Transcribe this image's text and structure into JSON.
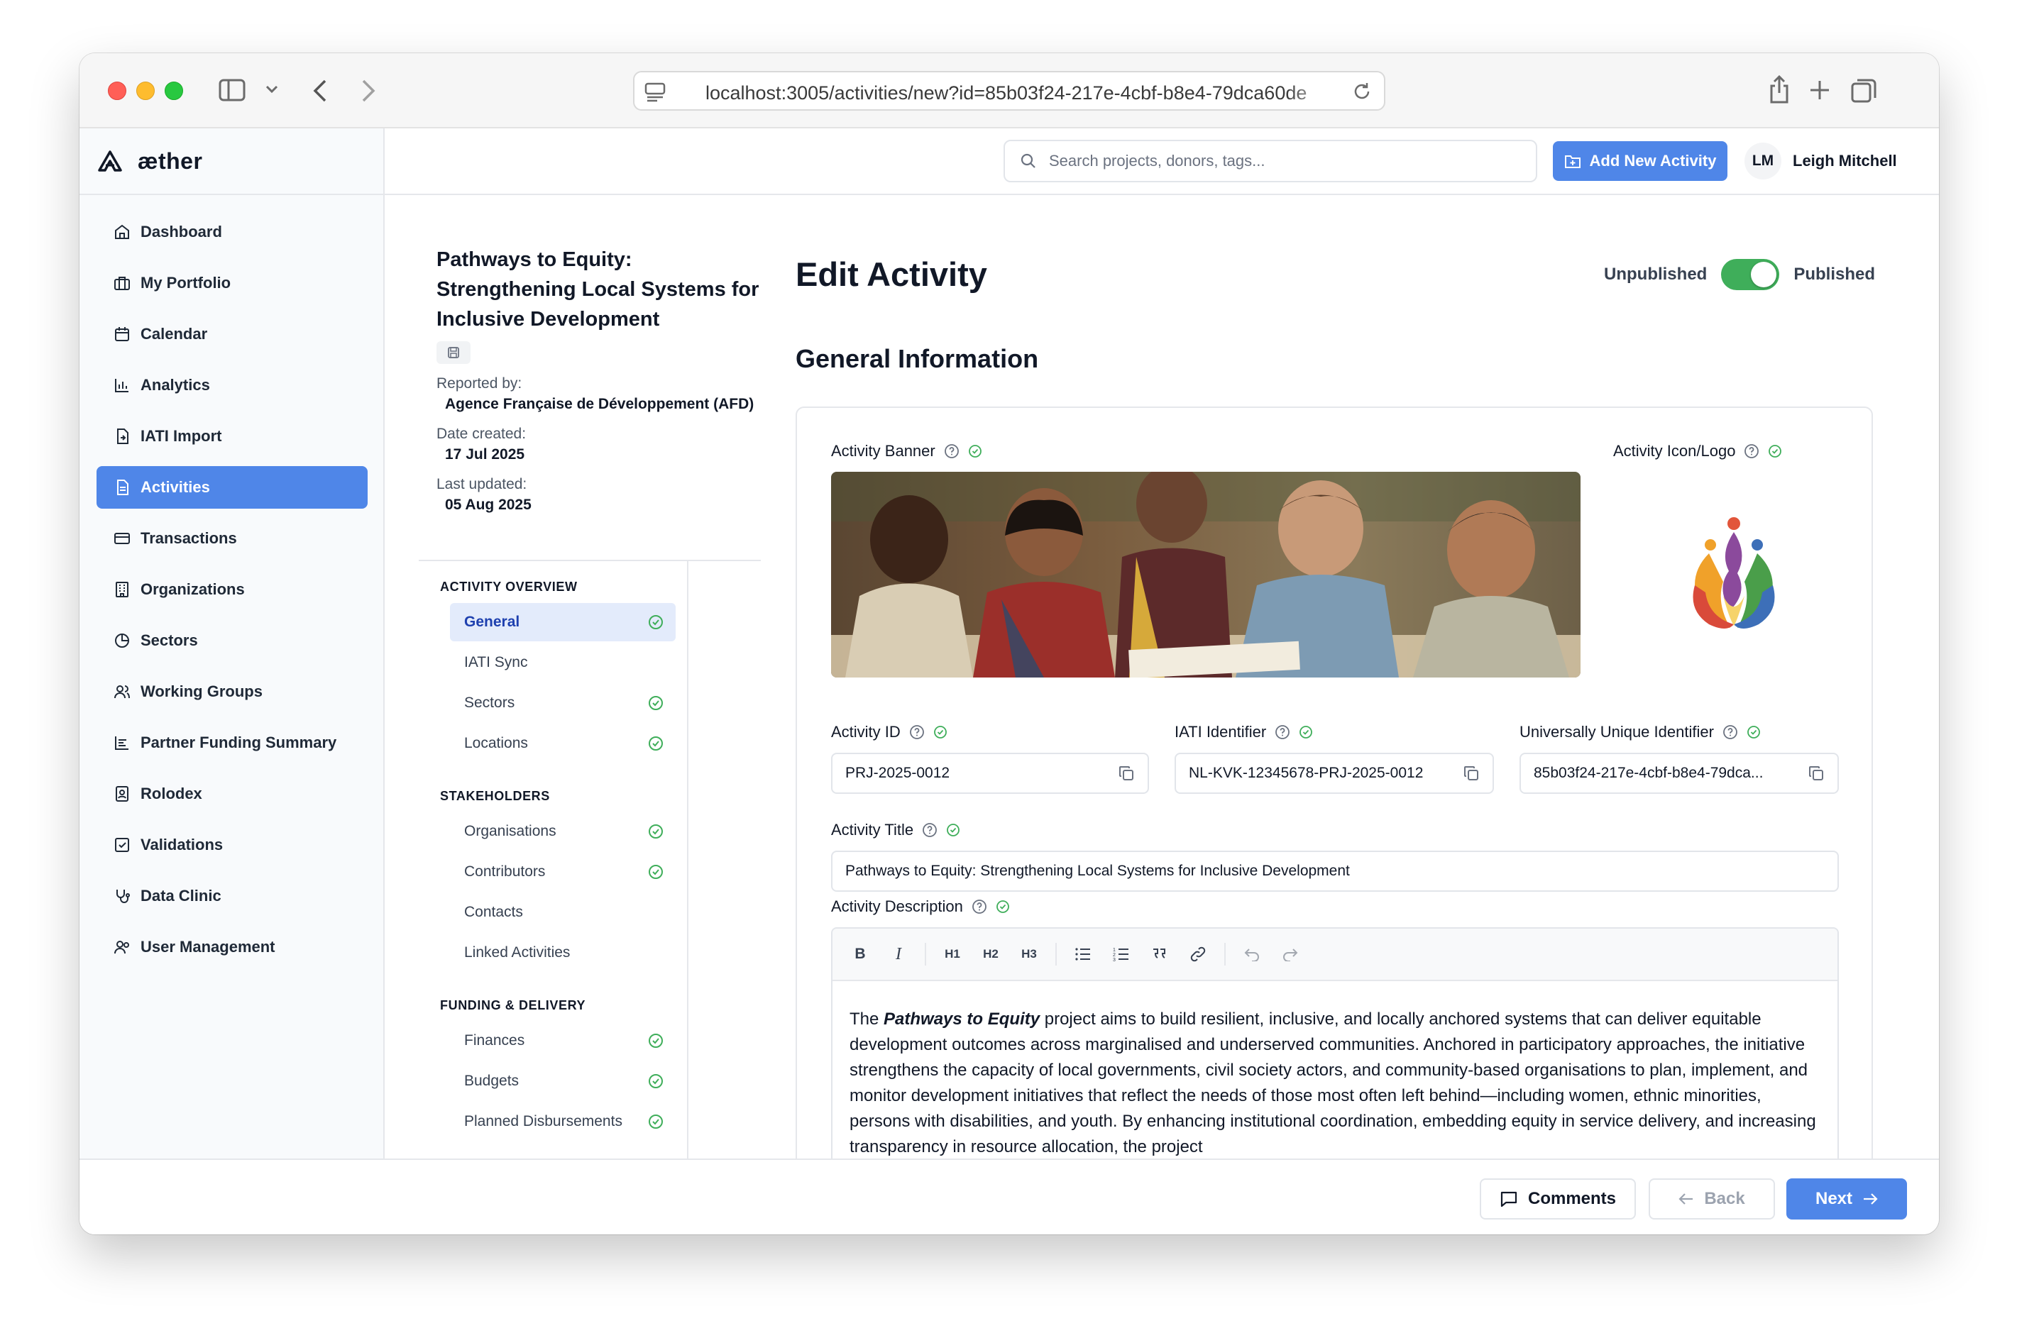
{
  "browser": {
    "url": "localhost:3005/activities/new?id=85b03f24-217e-4cbf-b8e4-79dca60de"
  },
  "app": {
    "brand": "æther",
    "search_placeholder": "Search projects, donors, tags...",
    "add_button": "Add New Activity",
    "user_initials": "LM",
    "user_name": "Leigh Mitchell"
  },
  "sidebar": {
    "items": [
      {
        "label": "Dashboard",
        "icon": "home-icon"
      },
      {
        "label": "My Portfolio",
        "icon": "briefcase-icon"
      },
      {
        "label": "Calendar",
        "icon": "calendar-icon"
      },
      {
        "label": "Analytics",
        "icon": "bar-chart-icon"
      },
      {
        "label": "IATI Import",
        "icon": "file-import-icon"
      },
      {
        "label": "Activities",
        "icon": "file-text-icon",
        "active": true
      },
      {
        "label": "Transactions",
        "icon": "credit-card-icon"
      },
      {
        "label": "Organizations",
        "icon": "building-icon"
      },
      {
        "label": "Sectors",
        "icon": "pie-chart-icon"
      },
      {
        "label": "Working Groups",
        "icon": "users-icon"
      },
      {
        "label": "Partner Funding Summary",
        "icon": "list-chart-icon"
      },
      {
        "label": "Rolodex",
        "icon": "contact-book-icon"
      },
      {
        "label": "Validations",
        "icon": "check-square-icon"
      },
      {
        "label": "Data Clinic",
        "icon": "stethoscope-icon"
      },
      {
        "label": "User Management",
        "icon": "user-group-icon"
      }
    ]
  },
  "summary": {
    "title": "Pathways to Equity: Strengthening Local Systems for Inclusive Development",
    "reported_by_label": "Reported by:",
    "reported_by": "Agence Française de Développement (AFD)",
    "date_created_label": "Date created:",
    "date_created": "17 Jul 2025",
    "last_updated_label": "Last updated:",
    "last_updated": "05 Aug 2025"
  },
  "subnav": {
    "sections": [
      {
        "title": "ACTIVITY OVERVIEW",
        "items": [
          {
            "label": "General",
            "done": true,
            "active": true
          },
          {
            "label": "IATI Sync",
            "done": false
          },
          {
            "label": "Sectors",
            "done": true
          },
          {
            "label": "Locations",
            "done": true
          }
        ]
      },
      {
        "title": "STAKEHOLDERS",
        "items": [
          {
            "label": "Organisations",
            "done": true
          },
          {
            "label": "Contributors",
            "done": true
          },
          {
            "label": "Contacts",
            "done": false
          },
          {
            "label": "Linked Activities",
            "done": false
          }
        ]
      },
      {
        "title": "FUNDING & DELIVERY",
        "items": [
          {
            "label": "Finances",
            "done": true
          },
          {
            "label": "Budgets",
            "done": true
          },
          {
            "label": "Planned Disbursements",
            "done": true
          }
        ]
      }
    ]
  },
  "editor": {
    "page_title": "Edit Activity",
    "unpublished_label": "Unpublished",
    "published_label": "Published",
    "published": true,
    "section_title": "General Information",
    "banner_label": "Activity Banner",
    "logo_label": "Activity Icon/Logo",
    "activity_id_label": "Activity ID",
    "activity_id": "PRJ-2025-0012",
    "iati_label": "IATI Identifier",
    "iati_id": "NL-KVK-12345678-PRJ-2025-0012",
    "uuid_label": "Universally Unique Identifier",
    "uuid": "85b03f24-217e-4cbf-b8e4-79dca...",
    "title_label": "Activity Title",
    "title_value": "Pathways to Equity: Strengthening Local Systems for Inclusive Development",
    "description_label": "Activity Description",
    "toolbar": [
      "B",
      "I",
      "H1",
      "H2",
      "H3"
    ],
    "description_lead": "The ",
    "description_bold": "Pathways to Equity",
    "description_rest": " project aims to build resilient, inclusive, and locally anchored systems that can deliver equitable development outcomes across marginalised and underserved communities. Anchored in participatory approaches, the initiative strengthens the capacity of local governments, civil society actors, and community-based organisations to plan, implement, and monitor development initiatives that reflect the needs of those most often left behind—including women, ethnic minorities, persons with disabilities, and youth. By enhancing institutional coordination, embedding equity in service delivery, and increasing transparency in resource allocation, the project"
  },
  "footer": {
    "comments": "Comments",
    "back": "Back",
    "next": "Next"
  },
  "colors": {
    "accent": "#4f86e8",
    "success": "#3fae5a"
  }
}
